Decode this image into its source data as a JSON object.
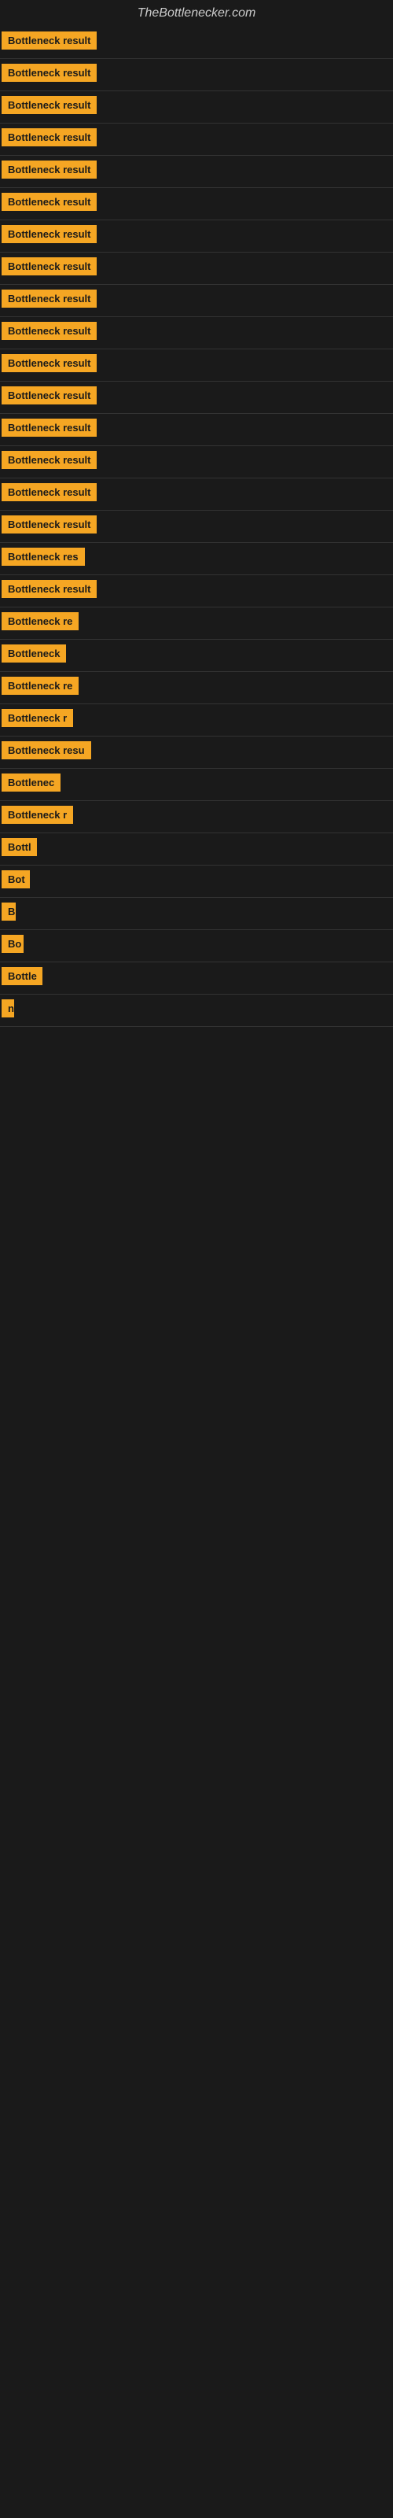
{
  "site": {
    "title": "TheBottlenecker.com"
  },
  "items": [
    {
      "label": "Bottleneck result",
      "width": 140,
      "fontSize": 13
    },
    {
      "label": "Bottleneck result",
      "width": 140,
      "fontSize": 13
    },
    {
      "label": "Bottleneck result",
      "width": 140,
      "fontSize": 13
    },
    {
      "label": "Bottleneck result",
      "width": 140,
      "fontSize": 13
    },
    {
      "label": "Bottleneck result",
      "width": 140,
      "fontSize": 13
    },
    {
      "label": "Bottleneck result",
      "width": 140,
      "fontSize": 13
    },
    {
      "label": "Bottleneck result",
      "width": 140,
      "fontSize": 13
    },
    {
      "label": "Bottleneck result",
      "width": 140,
      "fontSize": 13
    },
    {
      "label": "Bottleneck result",
      "width": 140,
      "fontSize": 13
    },
    {
      "label": "Bottleneck result",
      "width": 140,
      "fontSize": 13
    },
    {
      "label": "Bottleneck result",
      "width": 140,
      "fontSize": 13
    },
    {
      "label": "Bottleneck result",
      "width": 140,
      "fontSize": 13
    },
    {
      "label": "Bottleneck result",
      "width": 140,
      "fontSize": 13
    },
    {
      "label": "Bottleneck result",
      "width": 140,
      "fontSize": 13
    },
    {
      "label": "Bottleneck result",
      "width": 140,
      "fontSize": 13
    },
    {
      "label": "Bottleneck result",
      "width": 140,
      "fontSize": 13
    },
    {
      "label": "Bottleneck res",
      "width": 115,
      "fontSize": 13
    },
    {
      "label": "Bottleneck result",
      "width": 140,
      "fontSize": 13
    },
    {
      "label": "Bottleneck re",
      "width": 108,
      "fontSize": 13
    },
    {
      "label": "Bottleneck",
      "width": 85,
      "fontSize": 13
    },
    {
      "label": "Bottleneck re",
      "width": 108,
      "fontSize": 13
    },
    {
      "label": "Bottleneck r",
      "width": 98,
      "fontSize": 13
    },
    {
      "label": "Bottleneck resu",
      "width": 118,
      "fontSize": 13
    },
    {
      "label": "Bottlenec",
      "width": 78,
      "fontSize": 13
    },
    {
      "label": "Bottleneck r",
      "width": 95,
      "fontSize": 13
    },
    {
      "label": "Bottl",
      "width": 45,
      "fontSize": 13
    },
    {
      "label": "Bot",
      "width": 36,
      "fontSize": 13
    },
    {
      "label": "B",
      "width": 18,
      "fontSize": 13
    },
    {
      "label": "Bo",
      "width": 28,
      "fontSize": 13
    },
    {
      "label": "Bottle",
      "width": 52,
      "fontSize": 13
    },
    {
      "label": "n",
      "width": 14,
      "fontSize": 13
    }
  ]
}
